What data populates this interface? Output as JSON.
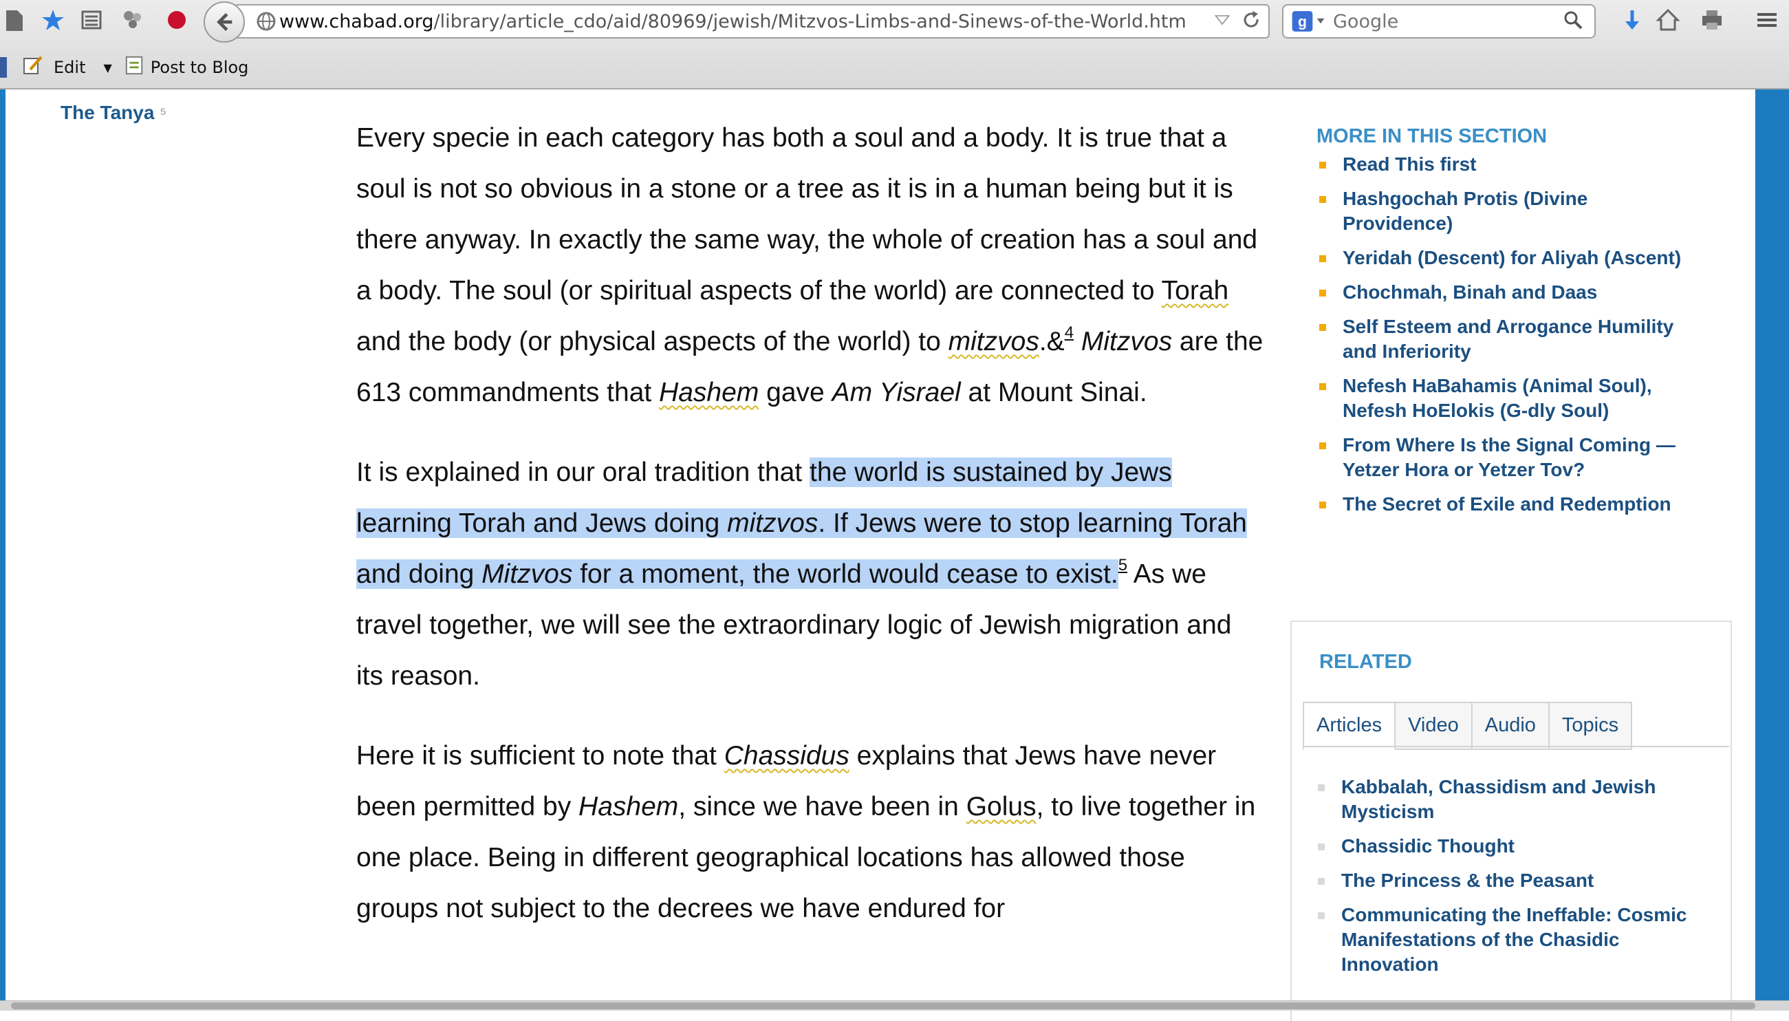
{
  "browser": {
    "url_domain": "www.chabad.org",
    "url_path": "/library/article_cdo/aid/80969/jewish/Mitzvos-Limbs-and-Sinews-of-the-World.htm",
    "search_placeholder": "Google",
    "bookmarks": {
      "edit_label": "Edit",
      "post_label": "Post to Blog"
    }
  },
  "nav": {
    "tanya_link": "The Tanya"
  },
  "article": {
    "p1": {
      "a": "Every specie in each category has both a soul and a body. It is true that a soul is not so obvious in a stone or a tree as it is in a human being but it is there anyway. In exactly the same way, the whole of creation has a soul and a body. The soul (or spiritual aspects of the world) are connected to ",
      "torah": "Torah",
      "b": " and the body (or physical aspects of the world) to ",
      "mitzvos": "mitzvos",
      "c": ".&",
      "fn": "4",
      "d": " ",
      "mitzvos2": "Mitzvos",
      "e": " are the 613 commandments that ",
      "hashem": "Hashem",
      "f": " gave ",
      "am_yisrael": "Am Yisrael",
      "g": " at Mount Sinai."
    },
    "p2": {
      "a": "It is explained in our oral tradition that ",
      "h1": "the world is sustained by Jews learning Torah and Jews doing ",
      "h_mitzvos": "mitzvos",
      "h2": ". If Jews were to stop learning Torah and doing ",
      "h_mitzvos2": "Mitzvos",
      "h3": " for a moment, the world would cease to exist.",
      "fn": "5",
      "b": " As we travel together, we will see the extraordinary logic of Jewish migration and its reason."
    },
    "p3": {
      "a": "Here it is sufficient to note that ",
      "chassidus": "Chassidus",
      "b": " explains that Jews have never been permitted by ",
      "hashem": "Hashem",
      "c": ", since we have been in ",
      "golus": "Golus",
      "d": ", to live together in one place. Being in different geographical locations has allowed those groups not subject to the decrees we have endured for"
    }
  },
  "sidebar": {
    "more_heading": "MORE IN THIS SECTION",
    "more_items": [
      "Read This first",
      "Hashgochah Protis (Divine Providence)",
      "Yeridah (Descent) for Aliyah (Ascent)",
      "Chochmah, Binah and Daas",
      "Self Esteem and Arrogance Humility and Inferiority",
      "Nefesh HaBahamis (Animal Soul), Nefesh HoElokis (G-dly Soul)",
      "From Where Is the Signal Coming — Yetzer Hora or Yetzer Tov?",
      "The Secret of Exile and Redemption"
    ],
    "related_heading": "RELATED",
    "tabs": [
      "Articles",
      "Video",
      "Audio",
      "Topics"
    ],
    "related_items": [
      "Kabbalah, Chassidism and Jewish Mysticism",
      "Chassidic Thought",
      "The Princess & the Peasant",
      "Communicating the Ineffable: Cosmic Manifestations of the Chasidic Innovation"
    ]
  }
}
